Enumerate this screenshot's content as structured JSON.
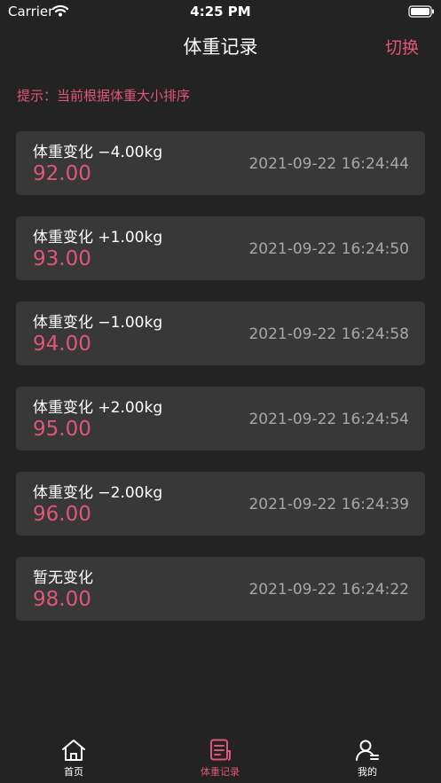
{
  "status_bar": {
    "carrier": "Carrier",
    "time": "4:25 PM"
  },
  "header": {
    "title": "体重记录",
    "switch_label": "切换"
  },
  "hint": "提示：当前根据体重大小排序",
  "records": [
    {
      "change": "体重变化 −4.00kg",
      "weight": "92.00",
      "time": "2021-09-22 16:24:44"
    },
    {
      "change": "体重变化 +1.00kg",
      "weight": "93.00",
      "time": "2021-09-22 16:24:50"
    },
    {
      "change": "体重变化 −1.00kg",
      "weight": "94.00",
      "time": "2021-09-22 16:24:58"
    },
    {
      "change": "体重变化 +2.00kg",
      "weight": "95.00",
      "time": "2021-09-22 16:24:54"
    },
    {
      "change": "体重变化 −2.00kg",
      "weight": "96.00",
      "time": "2021-09-22 16:24:39"
    },
    {
      "change": "暂无变化",
      "weight": "98.00",
      "time": "2021-09-22 16:24:22"
    }
  ],
  "tabs": [
    {
      "label": "首页",
      "icon": "home-icon"
    },
    {
      "label": "体重记录",
      "icon": "record-icon",
      "active": true
    },
    {
      "label": "我的",
      "icon": "profile-icon"
    }
  ],
  "colors": {
    "accent": "#e0557a",
    "background": "#232323",
    "card": "#383838",
    "muted_text": "#a8a8a8"
  }
}
